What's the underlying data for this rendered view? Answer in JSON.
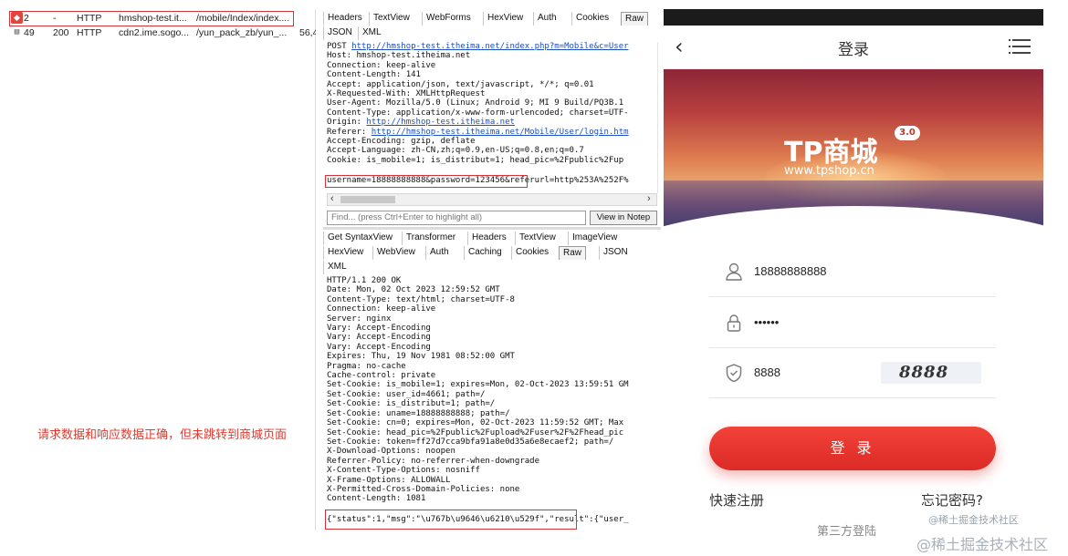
{
  "session_list": {
    "rows": [
      {
        "id": "2",
        "result": "-",
        "protocol": "HTTP",
        "host": "hmshop-test.it...",
        "url": "/mobile/Index/index....",
        "body": ""
      },
      {
        "id": "49",
        "result": "200",
        "protocol": "HTTP",
        "host": "cdn2.ime.sogo...",
        "url": "/yun_pack_zb/yun_...",
        "body": "56,4"
      }
    ]
  },
  "annotation": "请求数据和响应数据正确，但未跳转到商城页面",
  "request": {
    "tabs_row1": [
      "Headers",
      "TextView",
      "WebForms",
      "HexView",
      "Auth",
      "Cookies",
      "Raw"
    ],
    "tabs_row2": [
      "JSON",
      "XML"
    ],
    "active_tab": "Raw",
    "method": "POST ",
    "post_url": "http://hmshop-test.itheima.net/index.php?m=Mobile&c=User",
    "host": "Host: hmshop-test.itheima.net",
    "connection": "Connection: keep-alive",
    "content_length": "Content-Length: 141",
    "accept": "Accept: application/json, text/javascript, */*; q=0.01",
    "x_requested_with": "X-Requested-With: XMLHttpRequest",
    "user_agent": "User-Agent: Mozilla/5.0 (Linux; Android 9; MI 9 Build/PQ3B.1",
    "content_type": "Content-Type: application/x-www-form-urlencoded; charset=UTF-",
    "origin_label": "Origin: ",
    "origin_url": "http://hmshop-test.itheima.net",
    "referer_label": "Referer: ",
    "referer_url": "http://hmshop-test.itheima.net/Mobile/User/login.htm",
    "accept_encoding": "Accept-Encoding: gzip, deflate",
    "accept_language": "Accept-Language: zh-CN,zh;q=0.9,en-US;q=0.8,en;q=0.7",
    "cookie": "Cookie: is_mobile=1; is_distribut=1; head_pic=%2Fpublic%2Fup",
    "body": "username=18888888888&password=123456&referurl=http%253A%252F%"
  },
  "find_placeholder": "Find... (press Ctrl+Enter to highlight all)",
  "view_in_notepad": "View in Notep",
  "response": {
    "tabs_row1": [
      "Get SyntaxView",
      "Transformer",
      "Headers",
      "TextView",
      "ImageView"
    ],
    "tabs_row2": [
      "HexView",
      "WebView",
      "Auth",
      "Caching",
      "Cookies",
      "Raw",
      "JSON"
    ],
    "tabs_row3": [
      "XML"
    ],
    "active_tab": "Raw",
    "headers": [
      "HTTP/1.1 200 OK",
      "Date: Mon, 02 Oct 2023 12:59:52 GMT",
      "Content-Type: text/html; charset=UTF-8",
      "Connection: keep-alive",
      "Server: nginx",
      "Vary: Accept-Encoding",
      "Vary: Accept-Encoding",
      "Vary: Accept-Encoding",
      "Expires: Thu, 19 Nov 1981 08:52:00 GMT",
      "Pragma: no-cache",
      "Cache-control: private",
      "Set-Cookie: is_mobile=1; expires=Mon, 02-Oct-2023 13:59:51 GM",
      "Set-Cookie: user_id=4661; path=/",
      "Set-Cookie: is_distribut=1; path=/",
      "Set-Cookie: uname=18888888888; path=/",
      "Set-Cookie: cn=0; expires=Mon, 02-Oct-2023 11:59:52 GMT; Max",
      "Set-Cookie: head_pic=%2Fpublic%2Fupload%2Fuser%2F%2Fhead_pic",
      "Set-Cookie: token=ff27d7cca9bfa91a8e0d35a6e8ecaef2; path=/",
      "X-Download-Options: noopen",
      "Referrer-Policy: no-referrer-when-downgrade",
      "X-Content-Type-Options: nosniff",
      "X-Frame-Options: ALLOWALL",
      "X-Permitted-Cross-Domain-Policies: none",
      "Content-Length: 1081"
    ],
    "body": "{\"status\":1,\"msg\":\"\\u767b\\u9646\\u6210\\u529f\",\"result\":{\"user_"
  },
  "phone": {
    "title": "登录",
    "brand_logo": "TP商城",
    "brand_version": "3.0",
    "brand_url": "www.tpshop.cn",
    "username_value": "18888888888",
    "password_value": "••••••",
    "captcha_value": "8888",
    "captcha_image_text": "8888",
    "login_button": "登 录",
    "register_link": "快速注册",
    "forgot_link": "忘记密码?",
    "third_party": "第三方登陆",
    "watermark": "@稀土掘金技术社区"
  },
  "page_watermark": "@稀土掘金技术社区",
  "colors": {
    "highlight_box": "#d9303a",
    "annotation": "#e03a2f",
    "link": "#1a4fc6",
    "login_button": "#e8332d"
  }
}
